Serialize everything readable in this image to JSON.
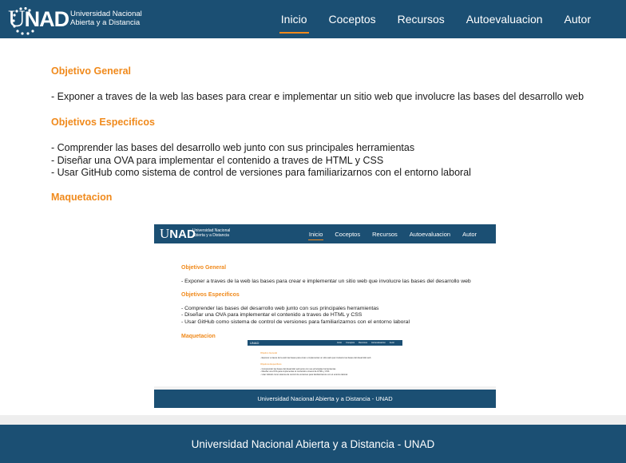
{
  "header": {
    "logo_text_u": "U",
    "logo_text_ad": "NAD",
    "logo_subtitle_line1": "Universidad Nacional",
    "logo_subtitle_line2": "Abierta y a  Distancia",
    "nav": [
      {
        "label": "Inicio",
        "active": true
      },
      {
        "label": "Coceptos",
        "active": false
      },
      {
        "label": "Recursos",
        "active": false
      },
      {
        "label": "Autoevaluacion",
        "active": false
      },
      {
        "label": "Autor",
        "active": false
      }
    ]
  },
  "main": {
    "objetivo_general_heading": "Objetivo General",
    "objetivo_general_text": "- Exponer a traves de la web las bases para crear e implementar un sitio web que involucre las bases del desarrollo web",
    "objetivos_especificos_heading": "Objetivos Especificos",
    "objetivos_especificos": [
      "- Comprender las bases del desarrollo web junto con sus principales herramientas",
      "- Diseñar una OVA para implementar el contenido a traves de HTML y CSS",
      "- Usar GitHub como sistema de control de versiones para familiarizarnos con el entorno laboral"
    ],
    "maquetacion_heading": "Maquetacion"
  },
  "preview": {
    "logo_u": "U",
    "logo_ad": "NAD",
    "subtitle_line1": "Universidad Nacional",
    "subtitle_line2": "Abierta y a  Distancia",
    "nav": [
      "Inicio",
      "Coceptos",
      "Recursos",
      "Autoevaluacion",
      "Autor"
    ],
    "objetivo_general_heading": "Objetivo General",
    "objetivo_general_text": "- Exponer a traves de la web las bases para crear e implementar un sitio web que involucre las bases del desarrollo web",
    "objetivos_especificos_heading": "Objetivos Especificos",
    "objetivos_especificos": [
      "- Comprender las bases del desarrollo web junto con sus principales herramientas",
      "- Diseñar una OVA para implementar el contenido a traves de HTML y CSS",
      "- Usar GitHub como sistema de control de versiones para familiarizarnos con el entorno laboral"
    ],
    "maquetacion_heading": "Maquetacion",
    "footer_text": "Universidad Nacional Abierta y a Distancia - UNAD",
    "mini": {
      "nav": [
        "Inicio",
        "Coceptos",
        "Recursos",
        "Autoevaluacion",
        "Autor"
      ],
      "heading1": "Objetivo General",
      "text1": "- Exponer a traves de la web las bases para crear e implementar un sitio web que involucre las bases del desarrollo web",
      "heading2": "Objetivos Especificos",
      "list": [
        "- Comprender las bases del desarrollo web junto con sus principales herramientas",
        "- Diseñar una OVA para implementar el contenido a traves de HTML y CSS",
        "- Usar GitHub como sistema de control de versiones para familiarizarnos con el entorno laboral"
      ]
    }
  },
  "footer": {
    "text": "Universidad Nacional Abierta y a Distancia - UNAD"
  },
  "colors": {
    "brand_blue": "#1b4f73",
    "accent_orange": "#f08a1c"
  }
}
